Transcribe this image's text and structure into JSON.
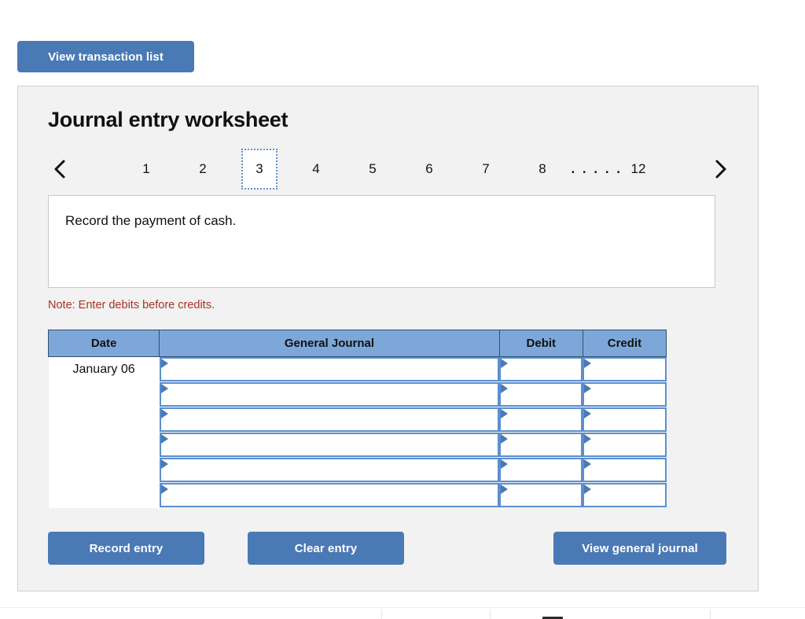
{
  "toolbar": {
    "view_transaction_list_label": "View transaction list"
  },
  "worksheet": {
    "title": "Journal entry worksheet",
    "prompt": "Record the payment of cash.",
    "note": "Note: Enter debits before credits."
  },
  "pager": {
    "prev_icon": "chevron-left-icon",
    "next_icon": "chevron-right-icon",
    "ellipsis": ". . . . .",
    "active_page": "3",
    "pages": [
      {
        "label": "1",
        "active": false
      },
      {
        "label": "2",
        "active": false
      },
      {
        "label": "3",
        "active": true
      },
      {
        "label": "4",
        "active": false
      },
      {
        "label": "5",
        "active": false
      },
      {
        "label": "6",
        "active": false
      },
      {
        "label": "7",
        "active": false
      },
      {
        "label": "8",
        "active": false
      },
      {
        "label": "12",
        "active": false
      }
    ]
  },
  "table": {
    "headers": {
      "date": "Date",
      "general_journal": "General Journal",
      "debit": "Debit",
      "credit": "Credit"
    },
    "rows": [
      {
        "date": "January 06",
        "general_journal": "",
        "debit": "",
        "credit": ""
      },
      {
        "date": "",
        "general_journal": "",
        "debit": "",
        "credit": ""
      },
      {
        "date": "",
        "general_journal": "",
        "debit": "",
        "credit": ""
      },
      {
        "date": "",
        "general_journal": "",
        "debit": "",
        "credit": ""
      },
      {
        "date": "",
        "general_journal": "",
        "debit": "",
        "credit": ""
      },
      {
        "date": "",
        "general_journal": "",
        "debit": "",
        "credit": ""
      }
    ]
  },
  "actions": {
    "record_entry_label": "Record entry",
    "clear_entry_label": "Clear entry",
    "view_general_journal_label": "View general journal"
  },
  "colors": {
    "button_blue": "#4a7ab5",
    "header_blue": "#7da7d9",
    "cell_border_blue": "#5b8fd0",
    "note_red": "#a93226",
    "panel_bg": "#f2f2f2"
  }
}
